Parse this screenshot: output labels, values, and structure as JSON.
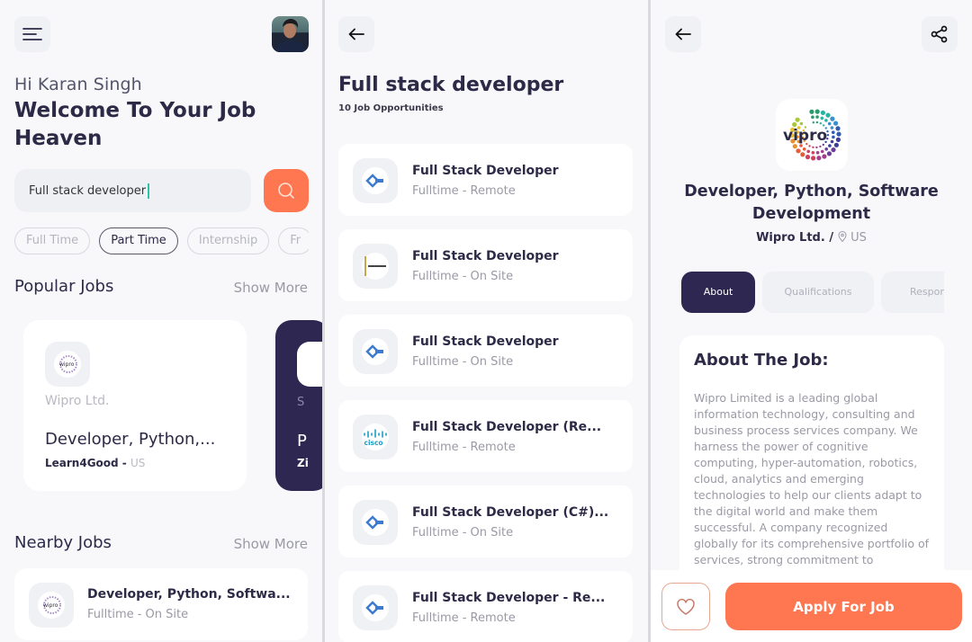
{
  "colors": {
    "accent": "#fe7751",
    "navy": "#2e2751",
    "text": "#2d2a47",
    "muted": "#9a9aa6"
  },
  "home": {
    "menu_icon": "hamburger-menu-icon",
    "greeting": "Hi Karan Singh",
    "welcome": "Welcome To Your Job Heaven",
    "search": {
      "value": "Full stack developer",
      "icon": "search-icon"
    },
    "chips": [
      "Full Time",
      "Part Time",
      "Internship",
      "Fr"
    ],
    "active_chip": "Part Time",
    "popular": {
      "title": "Popular Jobs",
      "show_more": "Show More",
      "cards": [
        {
          "company": "Wipro Ltd.",
          "title": "Developer, Python,...",
          "poster": "Learn4Good",
          "location": "US",
          "logo": "wipro"
        },
        {
          "company": "S",
          "title": "P",
          "poster": "Zi"
        }
      ]
    },
    "nearby": {
      "title": "Nearby Jobs",
      "show_more": "Show More",
      "items": [
        {
          "title": "Developer, Python, Softwa...",
          "subtitle": "Fulltime - On Site",
          "logo": "wipro"
        }
      ]
    }
  },
  "results": {
    "back_icon": "arrow-left-icon",
    "title": "Full stack developer",
    "count": "10 Job Opportunities",
    "jobs": [
      {
        "title": "Full Stack Developer",
        "subtitle": "Fulltime - Remote",
        "logo": "blue-cube"
      },
      {
        "title": "Full Stack Developer",
        "subtitle": "Fulltime - On Site",
        "logo": "gold-bar"
      },
      {
        "title": "Full Stack Developer",
        "subtitle": "Fulltime - On Site",
        "logo": "blue-cube"
      },
      {
        "title": "Full Stack Developer (Re...",
        "subtitle": "Fulltime - Remote",
        "logo": "cisco"
      },
      {
        "title": "Full Stack Developer (C#)...",
        "subtitle": "Fulltime - On Site",
        "logo": "blue-cube"
      },
      {
        "title": "Full Stack Developer - Re...",
        "subtitle": "Fulltime - Remote",
        "logo": "blue-cube"
      }
    ]
  },
  "detail": {
    "back_icon": "arrow-left-icon",
    "share_icon": "share-icon",
    "logo_text": "vipro",
    "title": "Developer, Python, Software Development",
    "company": "Wipro Ltd. /",
    "location": "US",
    "tabs": [
      "About",
      "Qualifications",
      "Respons"
    ],
    "active_tab": "About",
    "about_title": "About The Job:",
    "about_body": "Wipro Limited is a leading global information technology, consulting and business process services company. We harness the power of cognitive computing, hyper-automation, robotics, cloud, analytics and emerging technologies to help our clients adapt to the digital world and make them successful. A company recognized globally for its comprehensive portfolio of services, strong commitment to sustainability and good corporate citizenship.",
    "favorite_icon": "heart-icon",
    "apply_label": "Apply For Job"
  }
}
